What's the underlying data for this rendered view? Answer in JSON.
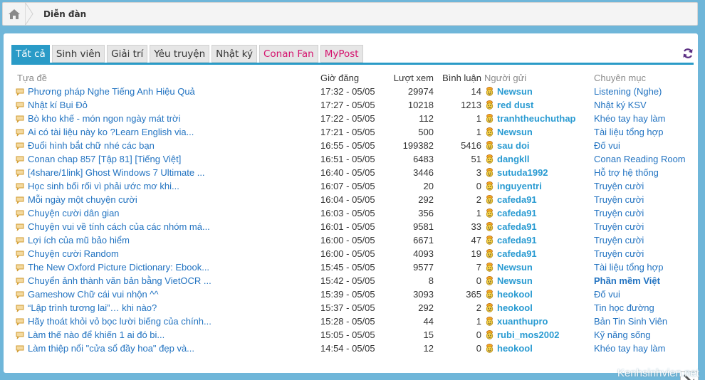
{
  "breadcrumb": {
    "current": "Diễn đàn"
  },
  "tabs": [
    {
      "label": "Tất cả",
      "active": true
    },
    {
      "label": "Sinh viên"
    },
    {
      "label": "Giải trí"
    },
    {
      "label": "Yêu truyện"
    },
    {
      "label": "Nhật ký"
    },
    {
      "label": "Conan Fan",
      "color": "#d4126d"
    },
    {
      "label": "MyPost",
      "color": "#d4126d"
    }
  ],
  "columns": [
    "Tựa đề",
    "Giờ đăng",
    "Lượt xem",
    "Bình luận",
    "Người gửi",
    "Chuyên mục"
  ],
  "rows": [
    {
      "title": "Phương pháp Nghe Tiếng Anh Hiệu Quả",
      "time": "17:32 - 05/05",
      "views": "29974",
      "replies": "14",
      "user": "Newsun",
      "category": "Listening (Nghe)"
    },
    {
      "title": "Nhật kí Bụi Đỏ",
      "time": "17:27 - 05/05",
      "views": "10218",
      "replies": "1213",
      "user": "red dust",
      "category": "Nhật ký KSV"
    },
    {
      "title": "Bò kho khế - món ngon ngày mát trời",
      "time": "17:22 - 05/05",
      "views": "112",
      "replies": "1",
      "user": "tranhtheuchuthap",
      "category": "Khéo tay hay làm"
    },
    {
      "title": "Ai có tài liệu này ko ?Learn English via...",
      "time": "17:21 - 05/05",
      "views": "500",
      "replies": "1",
      "user": "Newsun",
      "category": "Tài liệu tổng hợp"
    },
    {
      "title": "Đuổi hình bắt chữ nhé các bạn",
      "time": "16:55 - 05/05",
      "views": "199382",
      "replies": "5416",
      "user": "sau doi",
      "category": "Đố vui"
    },
    {
      "title": "Conan chap 857 [Tập 81] [Tiếng Việt]",
      "time": "16:51 - 05/05",
      "views": "6483",
      "replies": "51",
      "user": "dangkll",
      "category": "Conan Reading Room"
    },
    {
      "title": "[4share/1link] Ghost Windows 7 Ultimate ...",
      "time": "16:40 - 05/05",
      "views": "3446",
      "replies": "3",
      "user": "sutuda1992",
      "category": "Hỗ trợ hệ thống"
    },
    {
      "title": "Học sinh bối rối vì phải ước mơ khi...",
      "time": "16:07 - 05/05",
      "views": "20",
      "replies": "0",
      "user": "inguyentri",
      "category": "Truyện cười"
    },
    {
      "title": "Mỗi ngày một chuyện cười",
      "time": "16:04 - 05/05",
      "views": "292",
      "replies": "2",
      "user": "cafeda91",
      "category": "Truyện cười"
    },
    {
      "title": "Chuyện cười dân gian",
      "time": "16:03 - 05/05",
      "views": "356",
      "replies": "1",
      "user": "cafeda91",
      "category": "Truyện cười"
    },
    {
      "title": "Chuyện vui về tính cách của các nhóm má...",
      "time": "16:01 - 05/05",
      "views": "9581",
      "replies": "33",
      "user": "cafeda91",
      "category": "Truyện cười"
    },
    {
      "title": "Lợi ích của mũ bảo hiểm",
      "time": "16:00 - 05/05",
      "views": "6671",
      "replies": "47",
      "user": "cafeda91",
      "category": "Truyện cười"
    },
    {
      "title": "Chuyện cười Random",
      "time": "16:00 - 05/05",
      "views": "4093",
      "replies": "19",
      "user": "cafeda91",
      "category": "Truyện cười"
    },
    {
      "title": "The New Oxford Picture Dictionary: Ebook...",
      "time": "15:45 - 05/05",
      "views": "9577",
      "replies": "7",
      "user": "Newsun",
      "category": "Tài liệu tổng hợp"
    },
    {
      "title": "Chuyển ảnh thành văn bản bằng VietOCR ...",
      "time": "15:42 - 05/05",
      "views": "8",
      "replies": "0",
      "user": "Newsun",
      "category": "Phần mềm Việt",
      "category_bold": true
    },
    {
      "title": "Gameshow Chữ cái vui nhộn ^^",
      "time": "15:39 - 05/05",
      "views": "3093",
      "replies": "365",
      "user": "heokool",
      "category": "Đố vui"
    },
    {
      "title": "“Lập trình tương lai”… khi nào?",
      "time": "15:37 - 05/05",
      "views": "292",
      "replies": "2",
      "user": "heokool",
      "category": "Tin học đường"
    },
    {
      "title": "Hãy thoát khỏi vỏ bọc lười biếng của chính...",
      "time": "15:28 - 05/05",
      "views": "44",
      "replies": "1",
      "user": "xuanthupro",
      "category": "Bản Tin Sinh Viên"
    },
    {
      "title": "Làm thế nào để khiến 1 ai đó bi...",
      "time": "15:05 - 05/05",
      "views": "15",
      "replies": "0",
      "user": "rubi_mos2002",
      "category": "Kỹ năng sống"
    },
    {
      "title": "Làm thiệp nổi \"cửa sổ đầy hoa\" đẹp và...",
      "time": "14:54 - 05/05",
      "views": "12",
      "replies": "0",
      "user": "heokool",
      "category": "Khéo tay hay làm"
    }
  ],
  "watermark": "Kenhsinhvien.net",
  "icons": {
    "home": "home-icon",
    "refresh": "refresh-icon",
    "topic": "speech-bubble-icon",
    "user": "smiley-icon",
    "expand": "expand-arrow-icon"
  },
  "colors": {
    "accent": "#2a9bc7",
    "link": "#2273c1",
    "user": "#2a9bd2",
    "pink_tab": "#d4126d"
  }
}
